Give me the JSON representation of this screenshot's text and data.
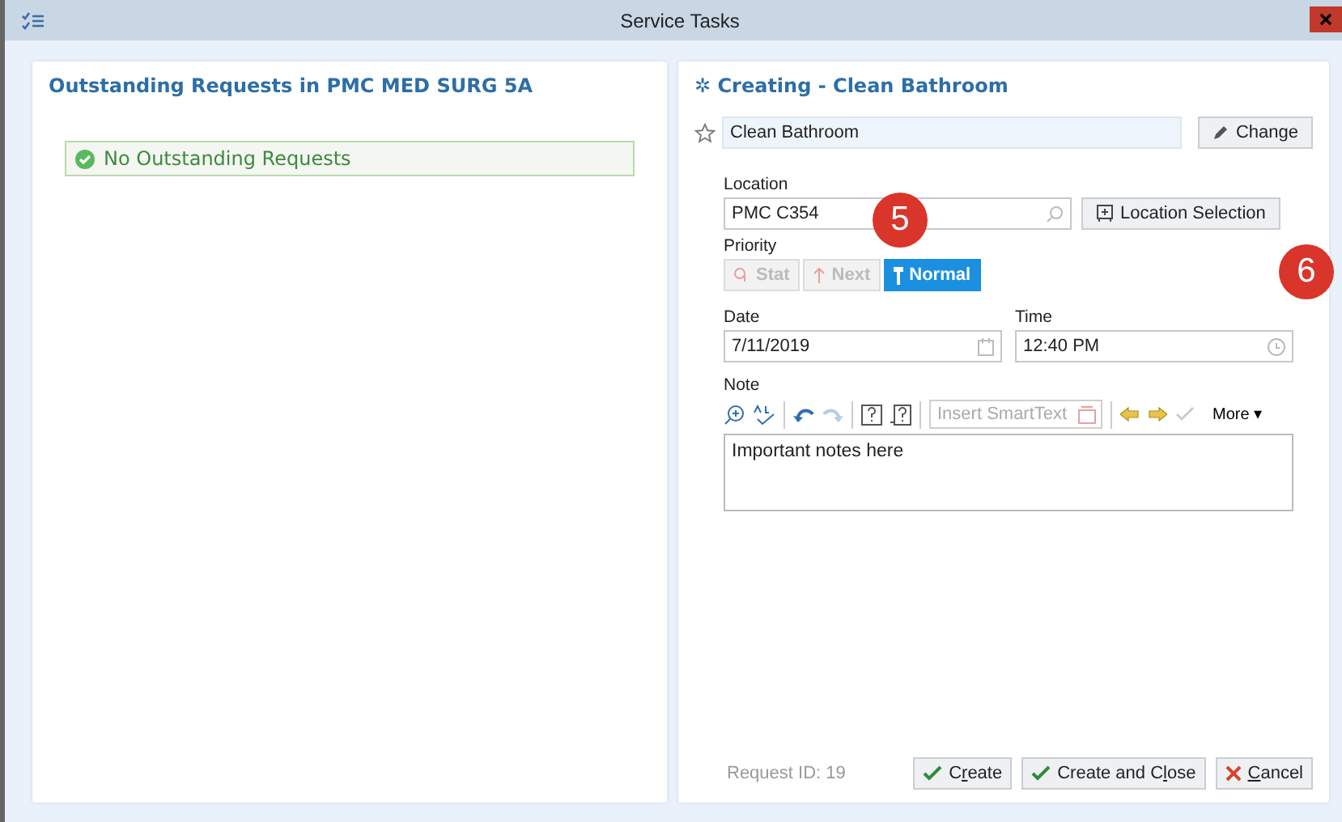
{
  "window": {
    "title": "Service Tasks"
  },
  "left_panel": {
    "title": "Outstanding Requests in PMC MED SURG 5A",
    "message": "No Outstanding Requests"
  },
  "right_panel": {
    "title_mark": "✲",
    "title": "Creating - Clean Bathroom",
    "task": {
      "value": "Clean Bathroom",
      "favorite": false
    },
    "change_button": "Change",
    "location": {
      "label": "Location",
      "value": "PMC C354",
      "selection_button": "Location Selection"
    },
    "priority": {
      "label": "Priority",
      "options": [
        {
          "label": "Stat",
          "kind": "stat",
          "selected": false
        },
        {
          "label": "Next",
          "kind": "next",
          "selected": false
        },
        {
          "label": "Normal",
          "kind": "normal",
          "selected": true
        }
      ]
    },
    "date": {
      "label": "Date",
      "value": "7/11/2019"
    },
    "time": {
      "label": "Time",
      "value": "12:40 PM"
    },
    "note": {
      "label": "Note",
      "smarttext_placeholder": "Insert SmartText",
      "more": "More",
      "more_caret": "▾",
      "value": "Important notes here"
    },
    "request_id": "Request ID: 19",
    "buttons": [
      {
        "kind": "ok",
        "before": "C",
        "key": "r",
        "after": "eate"
      },
      {
        "kind": "ok",
        "before": "Create and C",
        "key": "l",
        "after": "ose"
      },
      {
        "kind": "cancel",
        "key": "C",
        "after": "ancel"
      }
    ]
  },
  "callouts": [
    {
      "label": "5"
    },
    {
      "label": "6"
    }
  ]
}
